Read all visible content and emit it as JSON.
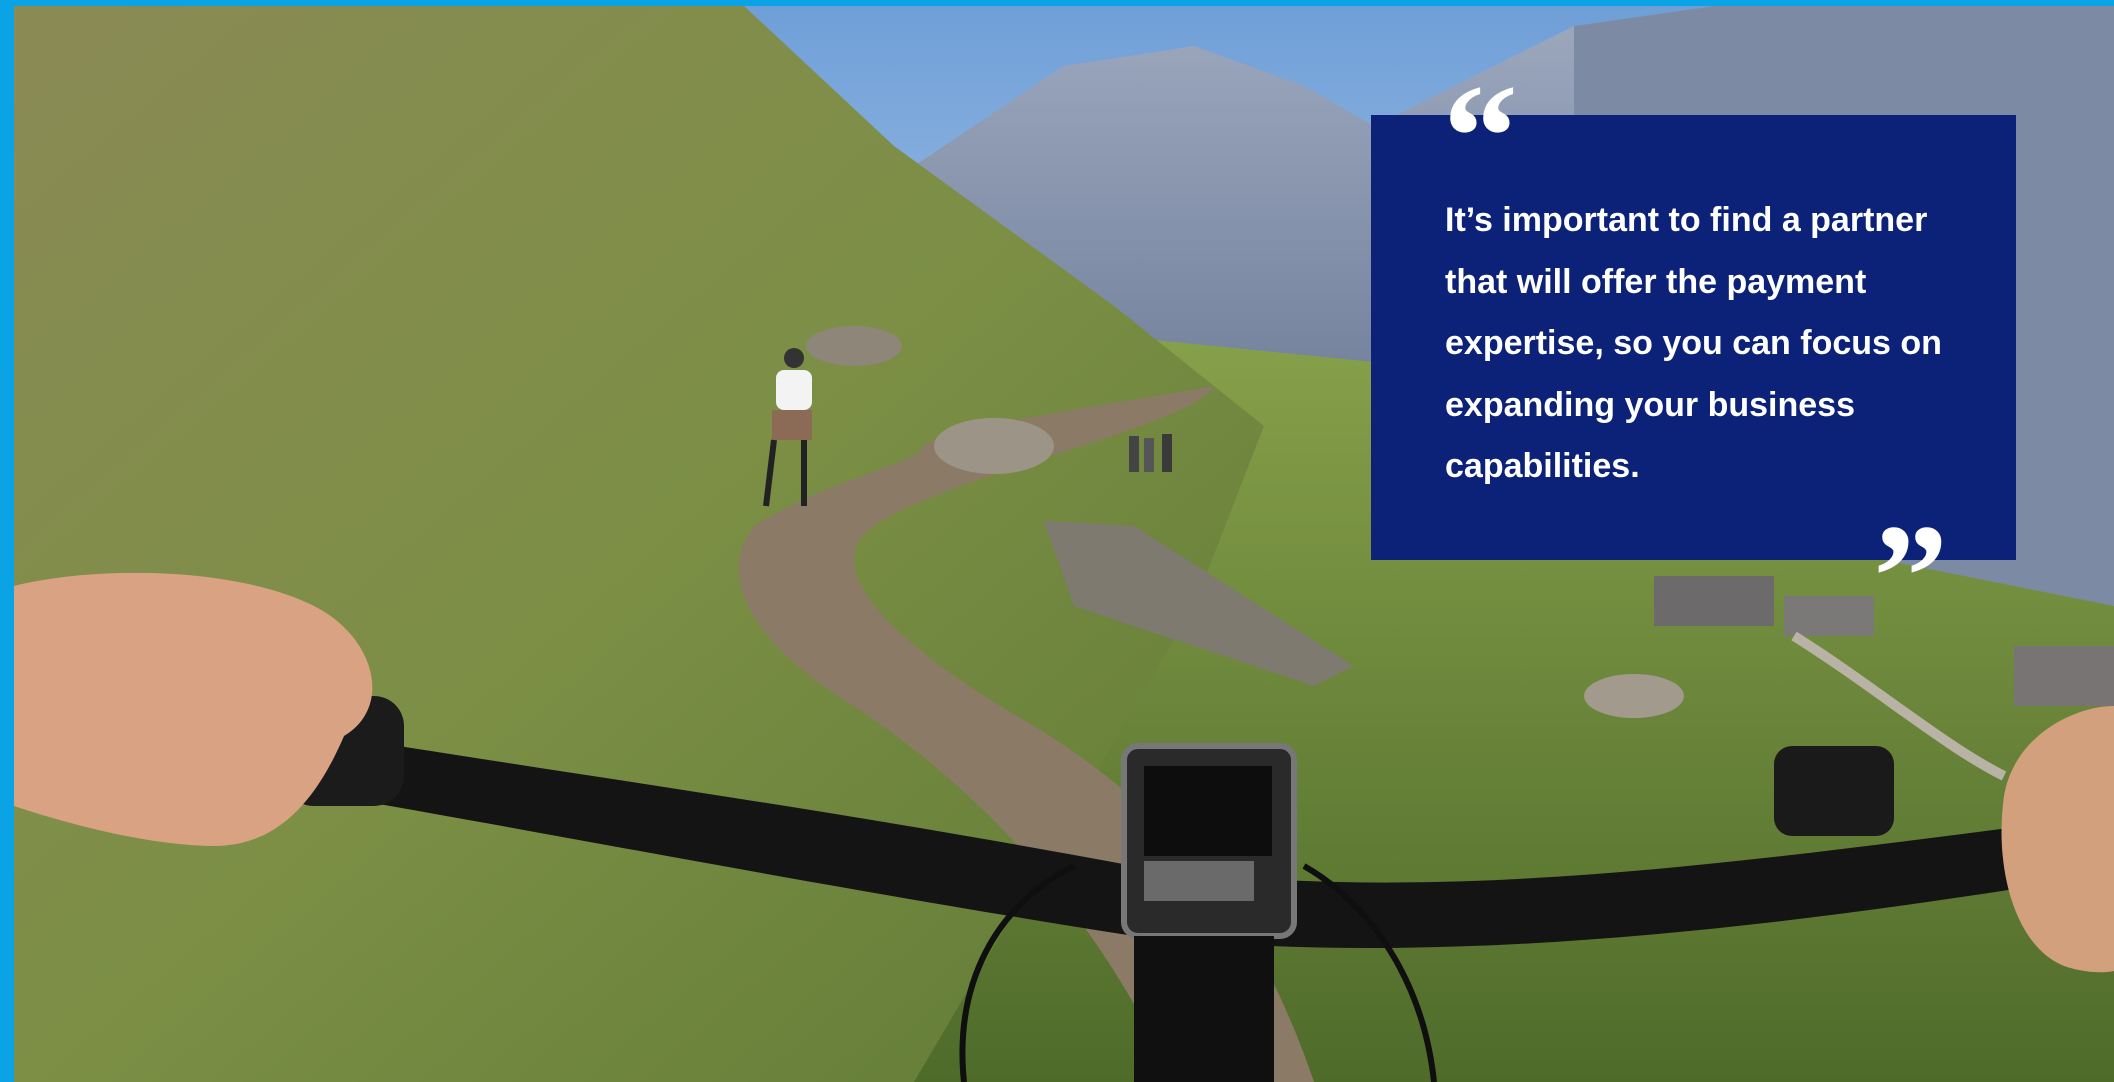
{
  "quote": {
    "text": "It’s important to find a partner that will offer the payment expertise, so you can focus on expanding your business capabilities.",
    "open_mark": "“",
    "close_mark": "”"
  },
  "colors": {
    "frame": "#0aa3e6",
    "quote_box": "#0c2279",
    "quote_text": "#ffffff"
  },
  "photo": {
    "subject": "first-person view over e-bike handlebars on a mountain trail with a rider ahead"
  }
}
